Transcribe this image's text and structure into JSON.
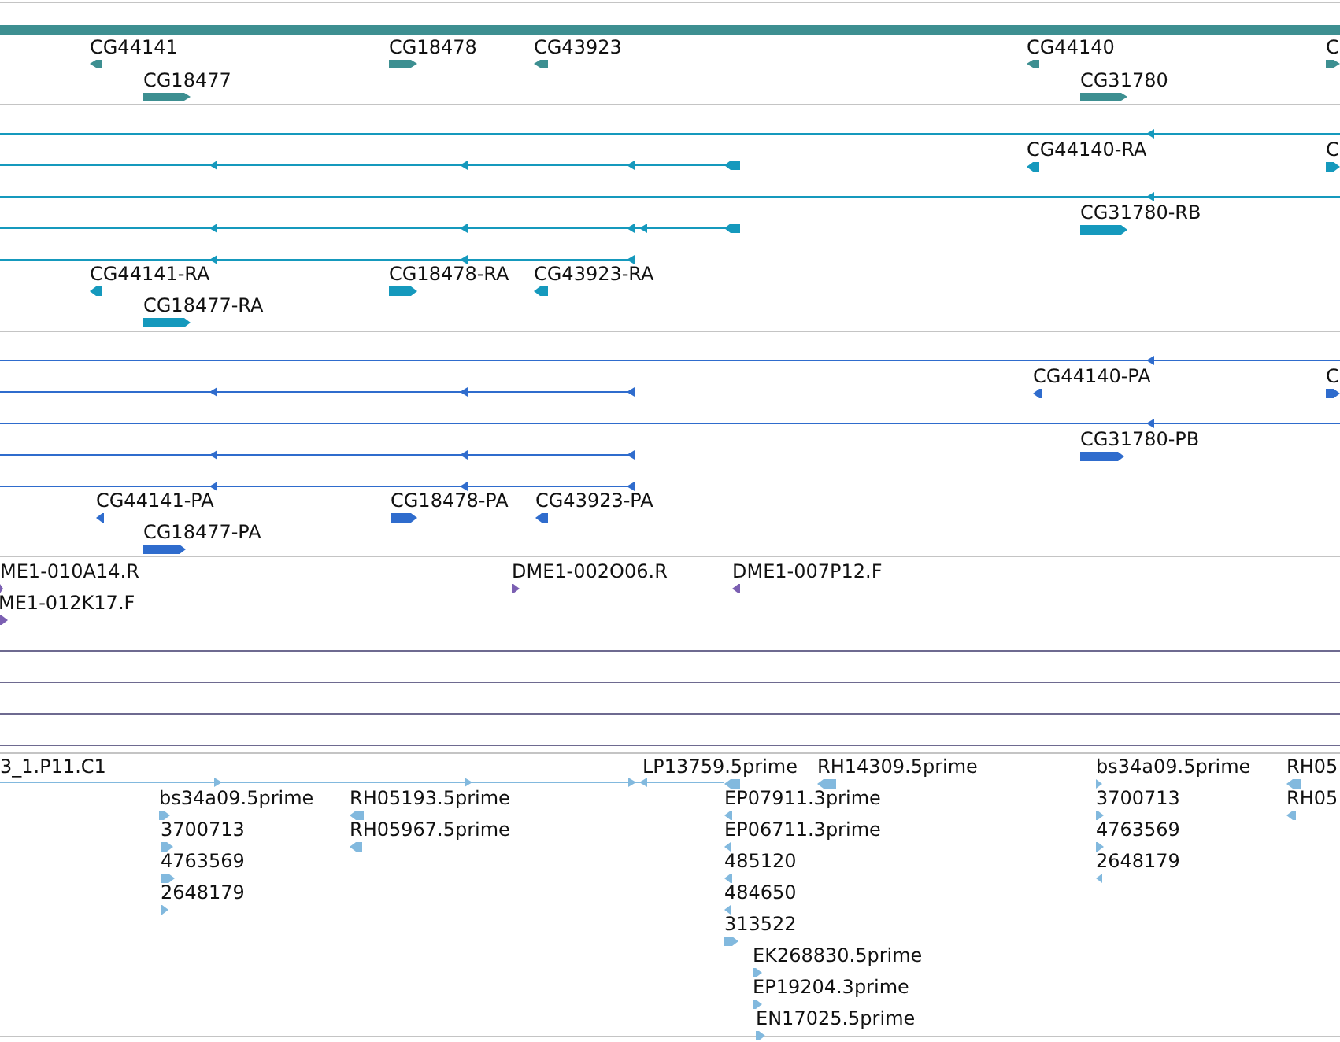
{
  "tracks": [
    {
      "kind": "gene",
      "features": [
        {
          "label": "CG44141"
        },
        {
          "label": "CG18477"
        },
        {
          "label": "CG18478"
        },
        {
          "label": "CG43923"
        },
        {
          "label": "CG44140"
        },
        {
          "label": "CG31780"
        },
        {
          "label": "C"
        }
      ]
    },
    {
      "kind": "transcript",
      "features": [
        {
          "label": "CG44140-RA"
        },
        {
          "label": "C"
        },
        {
          "label": "CG31780-RB"
        },
        {
          "label": "CG44141-RA"
        },
        {
          "label": "CG18478-RA"
        },
        {
          "label": "CG43923-RA"
        },
        {
          "label": "CG18477-RA"
        }
      ]
    },
    {
      "kind": "protein",
      "features": [
        {
          "label": "CG44140-PA"
        },
        {
          "label": "C"
        },
        {
          "label": "CG31780-PB"
        },
        {
          "label": "CG44141-PA"
        },
        {
          "label": "CG18478-PA"
        },
        {
          "label": "CG43923-PA"
        },
        {
          "label": "CG18477-PA"
        }
      ]
    },
    {
      "kind": "clone_end",
      "features": [
        {
          "label": "ME1-010A14.R"
        },
        {
          "label": "ME1-012K17.F"
        },
        {
          "label": "DME1-002O06.R"
        },
        {
          "label": "DME1-007P12.F"
        }
      ]
    },
    {
      "kind": "est",
      "features": [
        {
          "label": "3_1.P11.C1"
        },
        {
          "label": "LP13759.5prime"
        },
        {
          "label": "RH14309.5prime"
        },
        {
          "label": "bs34a09.5prime"
        },
        {
          "label": "3700713"
        },
        {
          "label": "4763569"
        },
        {
          "label": "2648179"
        },
        {
          "label": "RH05193.5prime"
        },
        {
          "label": "RH05967.5prime"
        },
        {
          "label": "EP07911.3prime"
        },
        {
          "label": "EP06711.3prime"
        },
        {
          "label": "485120"
        },
        {
          "label": "484650"
        },
        {
          "label": "313522"
        },
        {
          "label": "EK268830.5prime"
        },
        {
          "label": "EP19204.3prime"
        },
        {
          "label": "EN17025.5prime"
        },
        {
          "label": "bs34a09.5prime"
        },
        {
          "label": "3700713"
        },
        {
          "label": "4763569"
        },
        {
          "label": "2648179"
        },
        {
          "label": "RH05"
        },
        {
          "label": "RH05"
        }
      ]
    }
  ]
}
